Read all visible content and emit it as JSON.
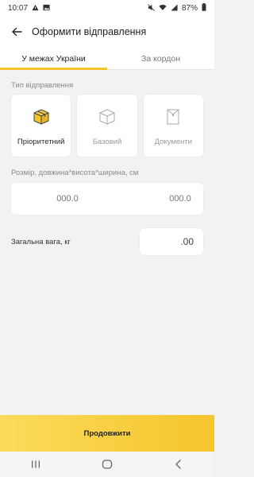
{
  "status_bar": {
    "time": "10:07",
    "battery": "87%",
    "left_icons": [
      "warning-icon",
      "image-icon"
    ],
    "right_icons": [
      "mute-icon",
      "wifi-icon",
      "signal-icon",
      "battery-icon"
    ]
  },
  "header": {
    "title": "Оформити відправлення",
    "back_icon": "arrow-left-icon"
  },
  "tabs": [
    {
      "label": "У межах України",
      "active": true
    },
    {
      "label": "За кордон",
      "active": false
    }
  ],
  "shipment_type": {
    "label": "Тип відправлення",
    "options": [
      {
        "label": "Пріоритетний",
        "icon": "box-filled-icon",
        "selected": true
      },
      {
        "label": "Базовий",
        "icon": "box-outline-icon",
        "selected": false
      },
      {
        "label": "Документи",
        "icon": "envelope-icon",
        "selected": false
      }
    ]
  },
  "dimensions": {
    "label": "Розмір, довжина*висота*ширина, см",
    "placeholders": [
      "000.0",
      "000.0",
      "000.0"
    ]
  },
  "weight": {
    "label": "Загальна вага, кг",
    "value": ".00"
  },
  "continue_label": "Продовжити",
  "colors": {
    "accent": "#f5c32c",
    "background": "#f2f2f2"
  }
}
